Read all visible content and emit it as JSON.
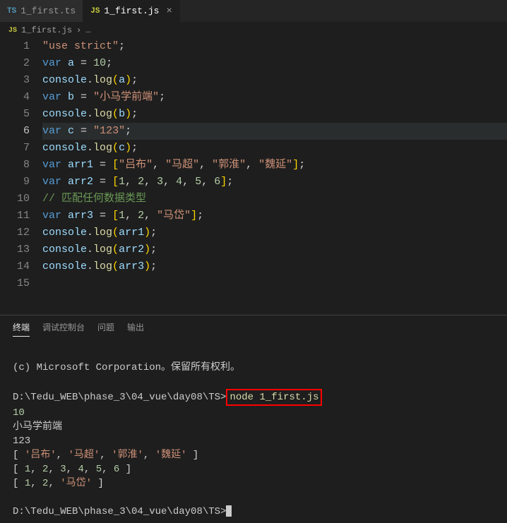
{
  "tabs": [
    {
      "icon": "TS",
      "label": "1_first.ts"
    },
    {
      "icon": "JS",
      "label": "1_first.js",
      "active": true
    }
  ],
  "breadcrumb": {
    "icon": "JS",
    "file": "1_first.js",
    "sep": "›",
    "more": "…"
  },
  "code": {
    "l1_kw": "\"use strict\"",
    "semi": ";",
    "var": "var",
    "a": "a",
    "eq": " = ",
    "n10": "10",
    "console": "console",
    "dot": ".",
    "log": "log",
    "lp": "(",
    "rp": ")",
    "b": "b",
    "str_b": "\"小马学前端\"",
    "c": "c",
    "str_c": "\"123\"",
    "arr1": "arr1",
    "lb": "[",
    "rb": "]",
    "cm": ", ",
    "s_lvbu": "\"吕布\"",
    "s_machao": "\"马超\"",
    "s_guohuai": "\"郭淮\"",
    "s_weiyan": "\"魏延\"",
    "arr2": "arr2",
    "n1": "1",
    "n2": "2",
    "n3": "3",
    "n4": "4",
    "n5": "5",
    "n6": "6",
    "comment": "// 匹配任何数据类型",
    "arr3": "arr3",
    "s_madai": "\"马岱\""
  },
  "panel": {
    "tabs": {
      "terminal": "终端",
      "debug": "调试控制台",
      "problems": "问题",
      "output": "输出"
    }
  },
  "terminal": {
    "copyright": "(c) Microsoft Corporation。保留所有权利。",
    "prompt_path": "D:\\Tedu_WEB\\phase_3\\04_vue\\day08\\TS>",
    "cmd": "node 1_first.js",
    "out1": "10",
    "out2": "小马学前端",
    "out3": "123",
    "arr1": {
      "lb": "[ ",
      "v1": "'吕布'",
      "c": ", ",
      "v2": "'马超'",
      "v3": "'郭淮'",
      "v4": "'魏延'",
      "rb": " ]"
    },
    "arr2": {
      "lb": "[ ",
      "n1": "1",
      "c": ", ",
      "n2": "2",
      "n3": "3",
      "n4": "4",
      "n5": "5",
      "n6": "6",
      "rb": " ]"
    },
    "arr3": {
      "lb": "[ ",
      "n1": "1",
      "c": ", ",
      "n2": "2",
      "v": "'马岱'",
      "rb": " ]"
    }
  }
}
